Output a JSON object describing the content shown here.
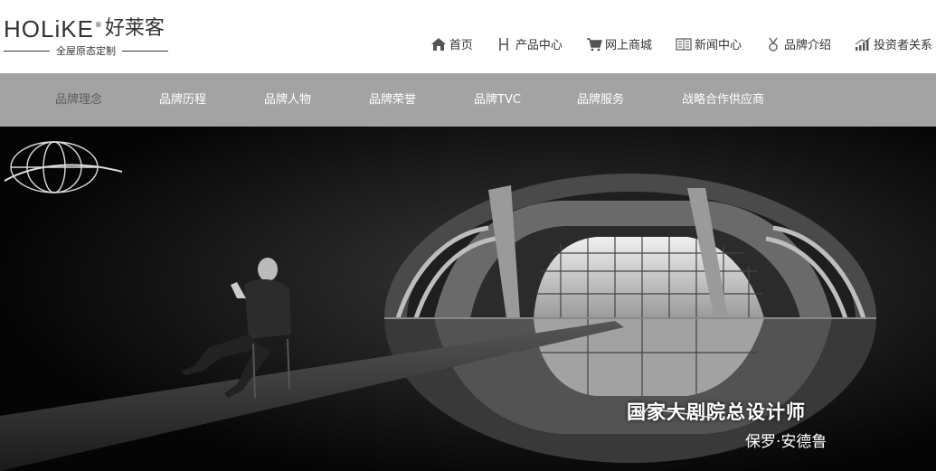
{
  "logo": {
    "brand": "HOLiKE",
    "reg": "®",
    "chinese": "好莱客",
    "tagline": "全屋原态定制"
  },
  "nav": {
    "items": [
      {
        "label": "首页",
        "icon": "home-icon"
      },
      {
        "label": "产品中心",
        "icon": "h-letter-icon"
      },
      {
        "label": "网上商城",
        "icon": "shopping-cart-icon"
      },
      {
        "label": "新闻中心",
        "icon": "newspaper-icon"
      },
      {
        "label": "品牌介绍",
        "icon": "medal-icon"
      },
      {
        "label": "投资者关系",
        "icon": "bar-chart-icon"
      }
    ]
  },
  "subnav": {
    "items": [
      {
        "label": "品牌理念",
        "active": true
      },
      {
        "label": "品牌历程"
      },
      {
        "label": "品牌人物"
      },
      {
        "label": "品牌荣誉"
      },
      {
        "label": "品牌TVC"
      },
      {
        "label": "品牌服务"
      },
      {
        "label": "战略合作供应商"
      }
    ]
  },
  "hero": {
    "caption_title": "国家大剧院总设计师",
    "caption_name": "保罗·安德鲁",
    "colors": {
      "background": "#050505",
      "subnav": "#a3a3a3"
    }
  }
}
